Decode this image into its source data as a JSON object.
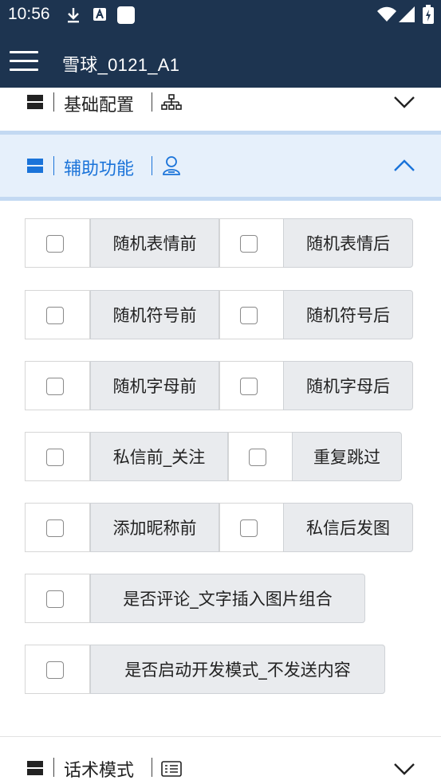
{
  "status_bar": {
    "time": "10:56"
  },
  "app_bar": {
    "title": "雪球_0121_A1"
  },
  "sections": {
    "basic": {
      "label": "基础配置",
      "expanded": false
    },
    "assist": {
      "label": "辅助功能",
      "expanded": true
    },
    "script_mode": {
      "label": "话术模式",
      "expanded": false
    }
  },
  "options": [
    {
      "label": "随机表情前",
      "checked": false
    },
    {
      "label": "随机表情后",
      "checked": false
    },
    {
      "label": "随机符号前",
      "checked": false
    },
    {
      "label": "随机符号后",
      "checked": false
    },
    {
      "label": "随机字母前",
      "checked": false
    },
    {
      "label": "随机字母后",
      "checked": false
    },
    {
      "label": "私信前_关注",
      "checked": false
    },
    {
      "label": "重复跳过",
      "checked": false
    },
    {
      "label": "添加昵称前",
      "checked": false
    },
    {
      "label": "私信后发图",
      "checked": false
    },
    {
      "label": "是否评论_文字插入图片组合",
      "checked": false
    },
    {
      "label": "是否启动开发模式_不发送内容",
      "checked": false
    }
  ],
  "colors": {
    "header_bg": "#1d3450",
    "accent": "#1a73d9",
    "label_bg": "#e9ebee",
    "active_section_bg": "#e6f0fb"
  }
}
